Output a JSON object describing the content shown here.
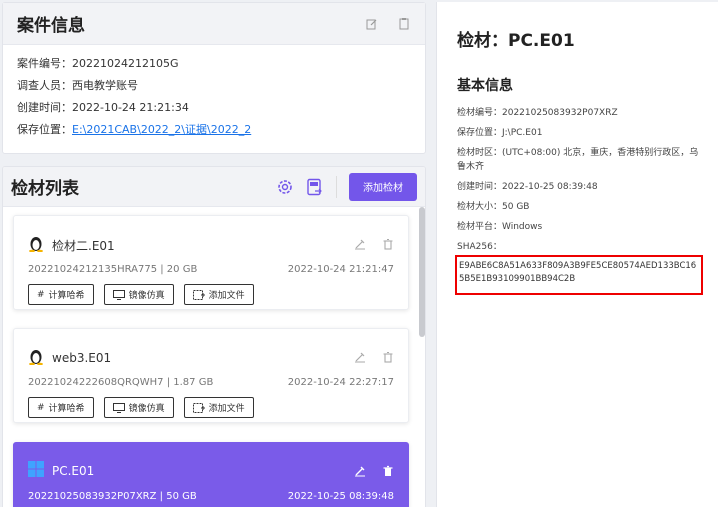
{
  "case": {
    "title": "案件信息",
    "fields": [
      {
        "label": "案件编号：",
        "value": "20221024212105G"
      },
      {
        "label": "调查人员：",
        "value": "西电教学账号"
      },
      {
        "label": "创建时间：",
        "value": "2022-10-24 21:21:34"
      },
      {
        "label": "保存位置：",
        "value": "E:\\2021CAB\\2022_2\\证据\\2022_2"
      }
    ]
  },
  "list": {
    "title": "检材列表",
    "add_label": "添加检材",
    "items": [
      {
        "name": "检材二.E01",
        "meta": "20221024212135HRA775 | 20 GB",
        "time": "2022-10-24 21:21:47",
        "os": "linux"
      },
      {
        "name": "web3.E01",
        "meta": "20221024222608QRQWH7 | 1.87 GB",
        "time": "2022-10-24 22:27:17",
        "os": "linux"
      },
      {
        "name": "PC.E01",
        "meta": "20221025083932P07XRZ | 50 GB",
        "time": "2022-10-25 08:39:48",
        "os": "windows"
      }
    ],
    "buttons": {
      "hash": "计算哈希",
      "mirror": "镜像仿真",
      "add_file": "添加文件"
    }
  },
  "detail": {
    "title": "检材：PC.E01",
    "section": "基本信息",
    "rows": [
      "检材编号：20221025083932P07XRZ",
      "保存位置：J:\\PC.E01",
      "检材时区：(UTC+08:00) 北京，重庆，香港特别行政区，乌鲁木齐",
      "创建时间：2022-10-25 08:39:48",
      "检材大小：50 GB",
      "检材平台：Windows"
    ],
    "sha_label": "SHA256：",
    "sha_value": "E9ABE6C8A51A633F809A3B9FE5CE80574AED133BC165B5E1B93109901BB94C2B"
  },
  "colors": {
    "accent": "#7356ea",
    "highlight": "#e00000",
    "link": "#1a73e8"
  }
}
